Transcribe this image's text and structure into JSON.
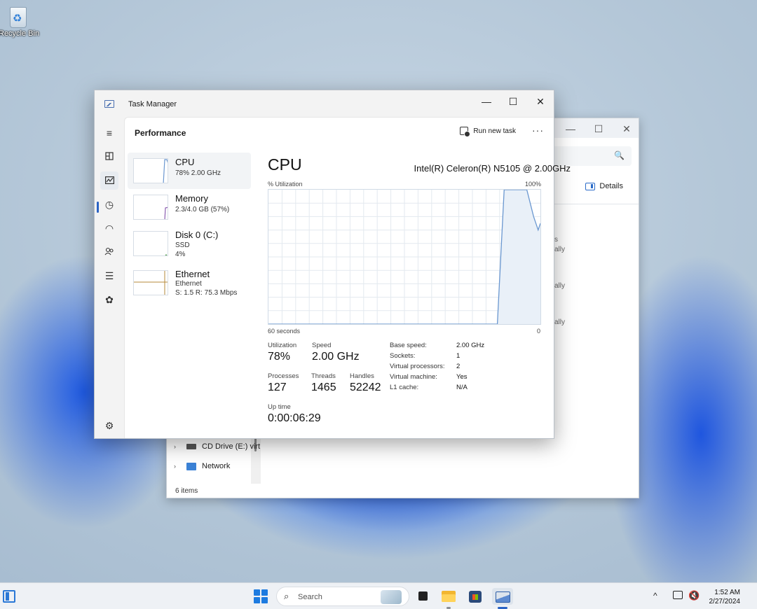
{
  "desktop": {
    "recycle_bin_label": "Recycle Bin"
  },
  "explorer": {
    "details_label": "Details",
    "nav_items": [
      "CD Drive (E:) virt",
      "Network"
    ],
    "status_text": "6 items",
    "truncated_text": [
      "s",
      "ally",
      "ally",
      "ally"
    ],
    "window_controls": [
      "—",
      "☐",
      "✕"
    ]
  },
  "task_manager": {
    "window_title": "Task Manager",
    "window_controls": [
      "—",
      "☐",
      "✕"
    ],
    "page_heading": "Performance",
    "run_new_task_label": "Run new task",
    "more_label": "···",
    "resources": [
      {
        "name": "CPU",
        "line1": "78%  2.00 GHz",
        "line2": ""
      },
      {
        "name": "Memory",
        "line1": "2.3/4.0 GB (57%)",
        "line2": ""
      },
      {
        "name": "Disk 0 (C:)",
        "line1": "SSD",
        "line2": "4%"
      },
      {
        "name": "Ethernet",
        "line1": "Ethernet",
        "line2": "S: 1.5  R: 75.3 Mbps"
      }
    ],
    "detail": {
      "title": "CPU",
      "model": "Intel(R) Celeron(R) N5105 @ 2.00GHz",
      "y_axis_label": "% Utilization",
      "y_max_label": "100%",
      "x_left_label": "60 seconds",
      "x_right_label": "0",
      "stats": {
        "utilization_label": "Utilization",
        "utilization_value": "78%",
        "speed_label": "Speed",
        "speed_value": "2.00 GHz",
        "processes_label": "Processes",
        "processes_value": "127",
        "threads_label": "Threads",
        "threads_value": "1465",
        "handles_label": "Handles",
        "handles_value": "52242",
        "uptime_label": "Up time",
        "uptime_value": "0:00:06:29"
      },
      "properties": [
        {
          "key": "Base speed:",
          "value": "2.00 GHz"
        },
        {
          "key": "Sockets:",
          "value": "1"
        },
        {
          "key": "Virtual processors:",
          "value": "2"
        },
        {
          "key": "Virtual machine:",
          "value": "Yes"
        },
        {
          "key": "L1 cache:",
          "value": "N/A"
        }
      ]
    }
  },
  "chart_data": {
    "type": "area",
    "x_label": "60 seconds",
    "y_label": "% Utilization",
    "xlim": [
      60,
      0
    ],
    "ylim": [
      0,
      100
    ],
    "grid": true,
    "x": [
      60,
      57,
      9.5,
      8,
      7,
      3,
      1.5,
      0.5,
      0
    ],
    "values": [
      0,
      0,
      0,
      100,
      100,
      100,
      80,
      70,
      75
    ],
    "color": "#6a97d0"
  },
  "taskbar": {
    "search_placeholder": "Search",
    "time": "1:52 AM",
    "date": "2/27/2024",
    "tray_chevron": "^"
  },
  "colors": {
    "accent": "#2a63c4",
    "graph_line": "#6a97d0",
    "graph_fill": "#e9f0f8",
    "grid": "#e3e9ef"
  }
}
